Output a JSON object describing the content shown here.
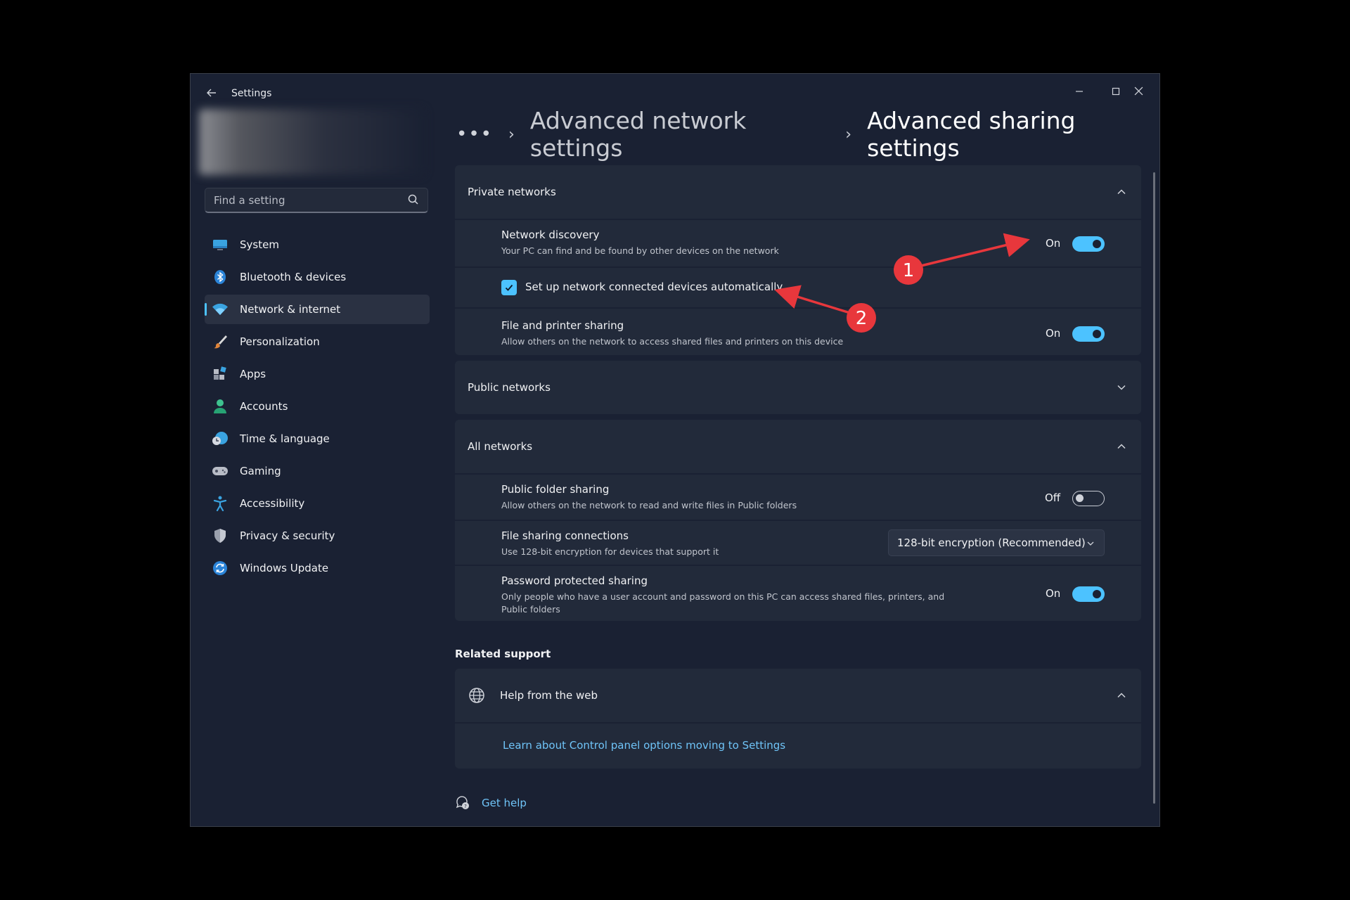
{
  "window": {
    "title": "Settings",
    "controls": [
      "minimize",
      "maximize",
      "close"
    ]
  },
  "search": {
    "placeholder": "Find a setting"
  },
  "sidebar": {
    "items": [
      {
        "label": "System",
        "icon": "system-icon",
        "active": false
      },
      {
        "label": "Bluetooth & devices",
        "icon": "bluetooth-icon",
        "active": false
      },
      {
        "label": "Network & internet",
        "icon": "wifi-icon",
        "active": true
      },
      {
        "label": "Personalization",
        "icon": "brush-icon",
        "active": false
      },
      {
        "label": "Apps",
        "icon": "apps-icon",
        "active": false
      },
      {
        "label": "Accounts",
        "icon": "person-icon",
        "active": false
      },
      {
        "label": "Time & language",
        "icon": "clock-globe-icon",
        "active": false
      },
      {
        "label": "Gaming",
        "icon": "gamepad-icon",
        "active": false
      },
      {
        "label": "Accessibility",
        "icon": "accessibility-icon",
        "active": false
      },
      {
        "label": "Privacy & security",
        "icon": "shield-icon",
        "active": false
      },
      {
        "label": "Windows Update",
        "icon": "update-icon",
        "active": false
      }
    ]
  },
  "breadcrumb": {
    "dots": "•••",
    "items": [
      "Advanced network settings",
      "Advanced sharing settings"
    ]
  },
  "private_networks": {
    "title": "Private networks",
    "expanded": true,
    "network_discovery": {
      "title": "Network discovery",
      "description": "Your PC can find and be found by other devices on the network",
      "state": "On"
    },
    "auto_setup": {
      "label": "Set up network connected devices automatically",
      "checked": true
    },
    "file_printer_sharing": {
      "title": "File and printer sharing",
      "description": "Allow others on the network to access shared files and printers on this device",
      "state": "On"
    }
  },
  "public_networks": {
    "title": "Public networks",
    "expanded": false
  },
  "all_networks": {
    "title": "All networks",
    "expanded": true,
    "public_folder_sharing": {
      "title": "Public folder sharing",
      "description": "Allow others on the network to read and write files in Public folders",
      "state": "Off"
    },
    "file_sharing_connections": {
      "title": "File sharing connections",
      "description": "Use 128-bit encryption for devices that support it",
      "selected": "128-bit encryption (Recommended)"
    },
    "password_protected_sharing": {
      "title": "Password protected sharing",
      "description_line1": "Only people who have a user account and password on this PC can access shared files, printers, and",
      "description_line2": "Public folders",
      "state": "On"
    }
  },
  "related_support": {
    "title": "Related support",
    "help_from_web": {
      "title": "Help from the web",
      "link": "Learn about Control panel options moving to Settings"
    }
  },
  "get_help": {
    "label": "Get help"
  },
  "annotations": {
    "marker_1": "1",
    "marker_2": "2",
    "color": "#e8373c"
  },
  "colors": {
    "accent": "#4cc2ff",
    "window_bg": "#1a2133",
    "card_bg": "#222a3a",
    "link": "#6fc4f8"
  }
}
